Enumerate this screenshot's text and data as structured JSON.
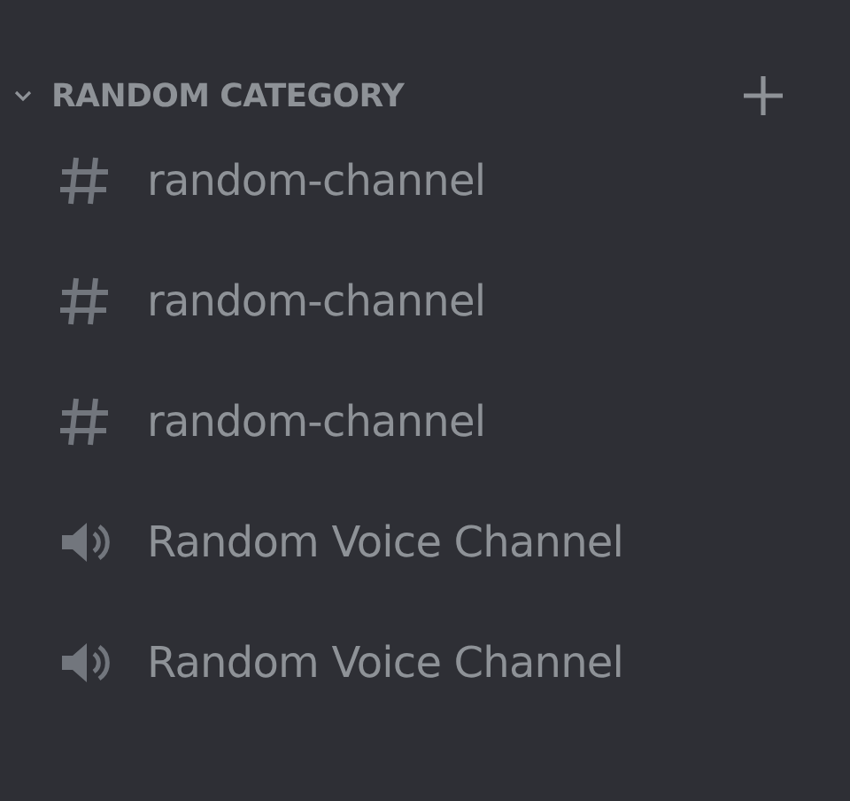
{
  "category": {
    "name": "RANDOM CATEGORY",
    "expanded": true
  },
  "channels": [
    {
      "kind": "text",
      "name": "random-channel"
    },
    {
      "kind": "text",
      "name": "random-channel"
    },
    {
      "kind": "text",
      "name": "random-channel"
    },
    {
      "kind": "voice",
      "name": "Random Voice Channel"
    },
    {
      "kind": "voice",
      "name": "Random Voice Channel"
    }
  ]
}
